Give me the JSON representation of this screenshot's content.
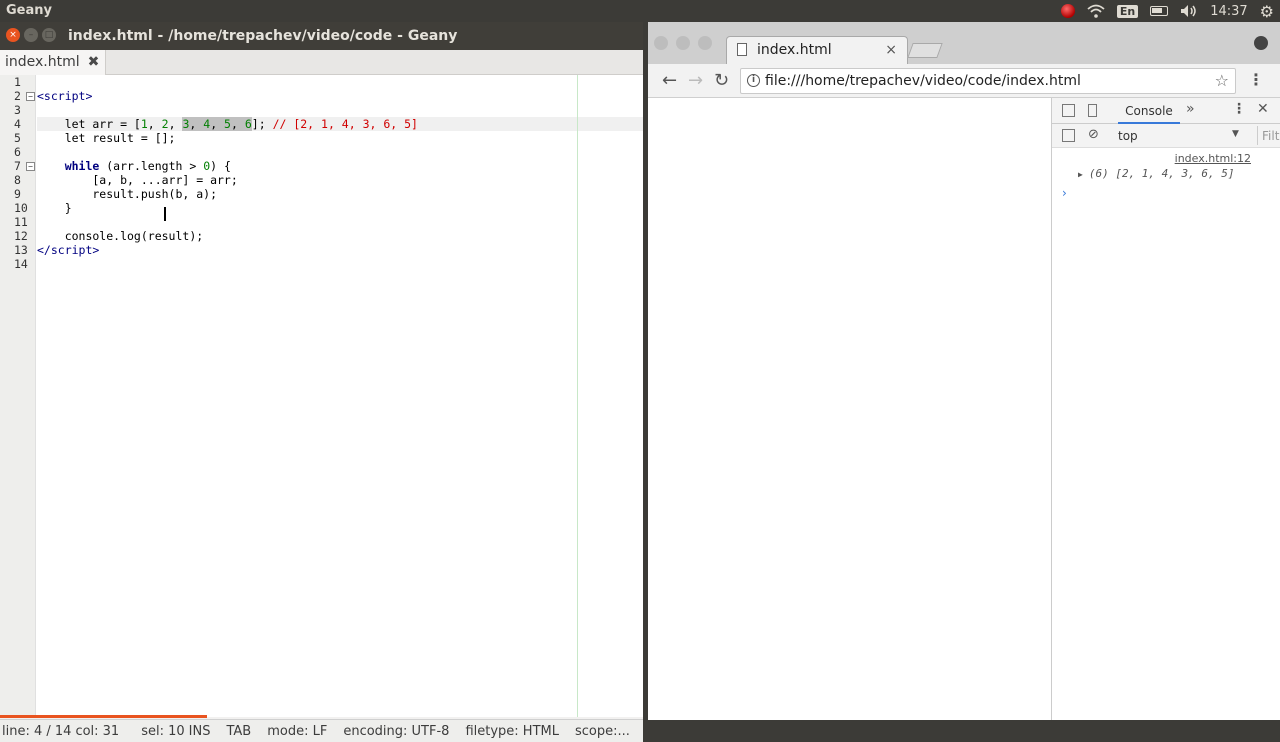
{
  "panel": {
    "app_name": "Geany",
    "keyboard": "En",
    "time": "14:37"
  },
  "geany": {
    "window_title": "index.html - /home/trepachev/video/code - Geany",
    "tab_label": "index.html",
    "tab_close": "✖",
    "line_numbers": [
      "1",
      "2",
      "3",
      "4",
      "5",
      "6",
      "7",
      "8",
      "9",
      "10",
      "11",
      "12",
      "13",
      "14"
    ],
    "status": {
      "line": "line: 4 / 14",
      "col": "col: 31",
      "sel": "sel: 10",
      "ins": "INS",
      "tab": "TAB",
      "mode": "mode: LF",
      "encoding": "encoding: UTF-8",
      "filetype": "filetype: HTML",
      "scope": "scope:..."
    }
  },
  "chrome": {
    "tab_title": "index.html",
    "tab_close": "×",
    "url": "file:///home/trepachev/video/code/index.html",
    "devtools": {
      "panel_tab": "Console",
      "context": "top",
      "filter_placeholder": "Filt",
      "log_source": "index.html:12",
      "log_entry": "(6) [2, 1, 4, 3, 6, 5]",
      "prompt": "›"
    }
  },
  "colors": {
    "accent": "#e95420",
    "devtools_blue": "#3879d9"
  }
}
